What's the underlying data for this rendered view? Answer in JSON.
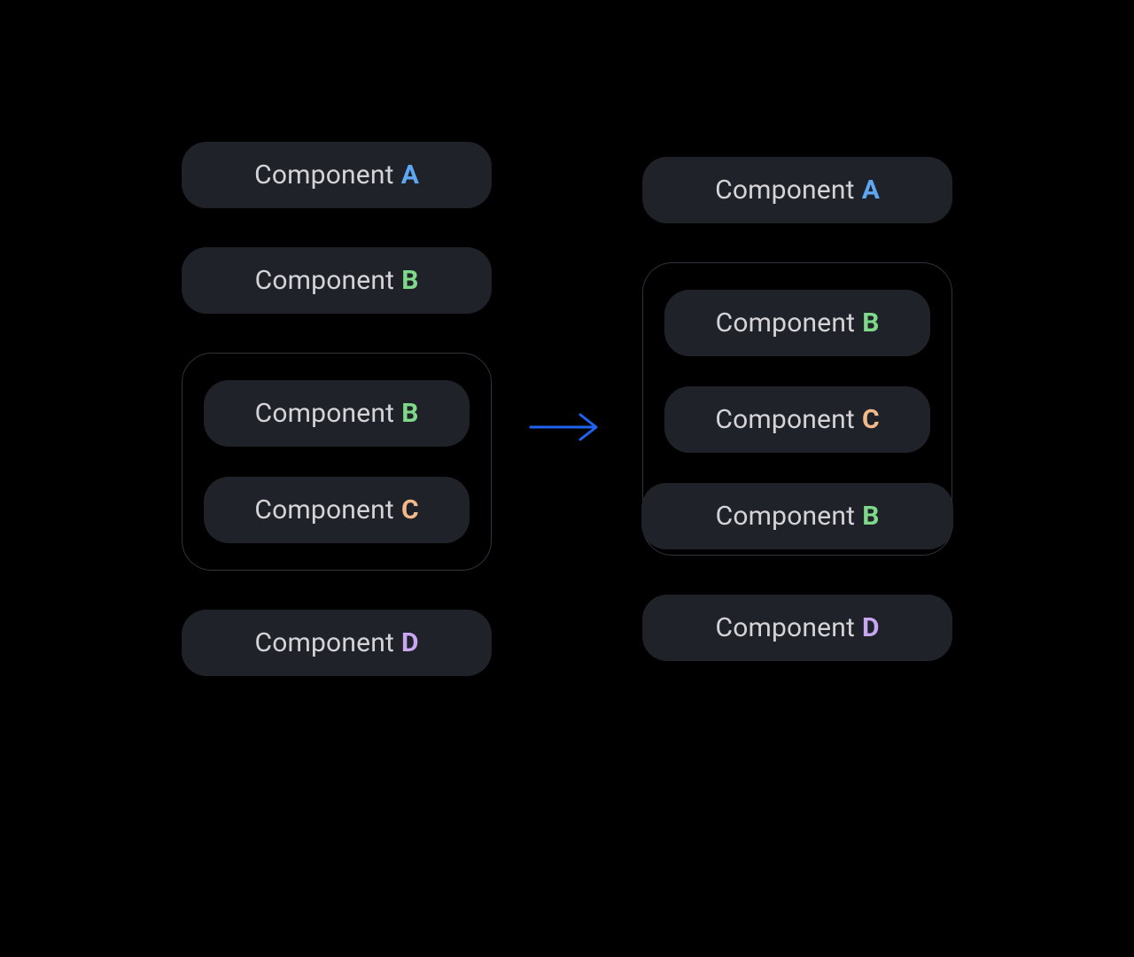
{
  "labels": {
    "prefix": "Component"
  },
  "letters": {
    "A": "A",
    "B": "B",
    "C": "C",
    "D": "D"
  },
  "colors": {
    "A": "#5ea7f2",
    "B": "#7fd98a",
    "C": "#f2b98a",
    "D": "#c9a6f0"
  },
  "left": {
    "top": {
      "letter": "A"
    },
    "second": {
      "letter": "B"
    },
    "group": [
      {
        "letter": "B"
      },
      {
        "letter": "C"
      }
    ],
    "bottom": {
      "letter": "D"
    }
  },
  "right": {
    "top": {
      "letter": "A"
    },
    "group": [
      {
        "letter": "B"
      },
      {
        "letter": "C"
      },
      {
        "letter": "B"
      }
    ],
    "bottom": {
      "letter": "D"
    }
  }
}
